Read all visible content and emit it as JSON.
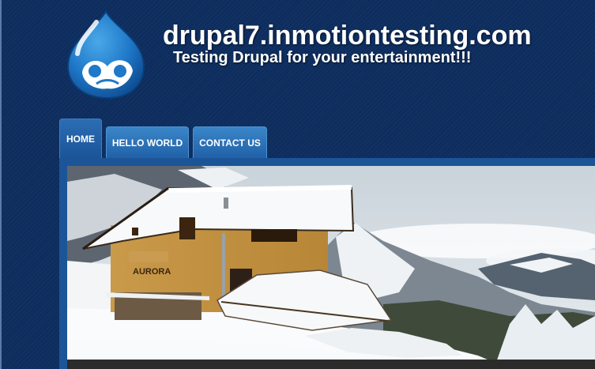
{
  "header": {
    "site_name": "drupal7.inmotiontesting.com",
    "site_slogan": "Testing Drupal for your entertainment!!!",
    "logo_icon": "drupal-drop-icon"
  },
  "nav": {
    "items": [
      {
        "label": "HOME",
        "active": true
      },
      {
        "label": "HELLO WORLD",
        "active": false
      },
      {
        "label": "CONTACT US",
        "active": false
      }
    ]
  },
  "hero": {
    "sign_text": "AURORA",
    "image": "snow-covered-mountain-hut"
  },
  "colors": {
    "background": "#0d2d5e",
    "tab": "#2f78c0",
    "frame": "#1c5597",
    "text": "#ffffff"
  }
}
